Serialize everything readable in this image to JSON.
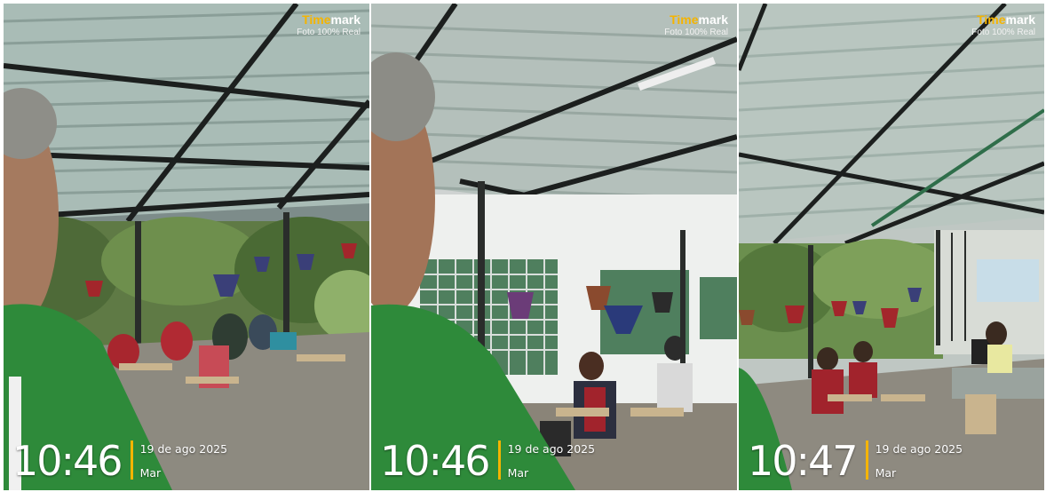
{
  "photos": [
    {
      "brand_a": "Time",
      "brand_b": "mark",
      "subtitle": "Foto 100% Real",
      "time": "10:46",
      "date": "19 de ago 2025",
      "day": "Mar"
    },
    {
      "brand_a": "Time",
      "brand_b": "mark",
      "subtitle": "Foto 100% Real",
      "time": "10:46",
      "date": "19 de ago 2025",
      "day": "Mar"
    },
    {
      "brand_a": "Time",
      "brand_b": "mark",
      "subtitle": "Foto 100% Real",
      "time": "10:47",
      "date": "19 de ago 2025",
      "day": "Mar"
    }
  ]
}
